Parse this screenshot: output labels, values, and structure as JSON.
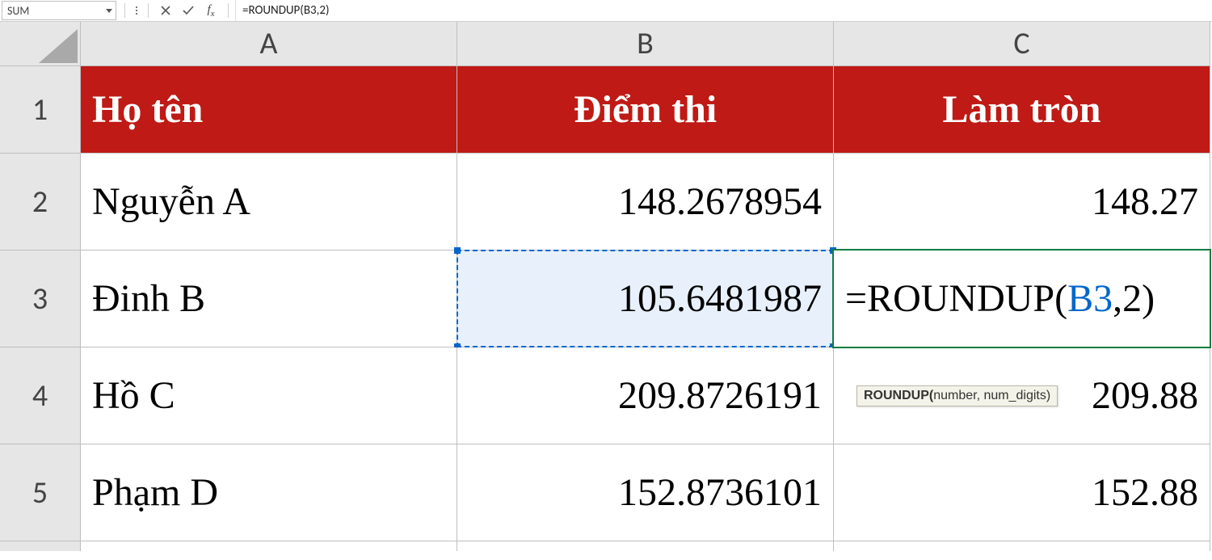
{
  "formula_bar": {
    "name_box": "SUM",
    "formula": "=ROUNDUP(B3,2)"
  },
  "columns": [
    "A",
    "B",
    "C"
  ],
  "row_numbers": [
    "1",
    "2",
    "3",
    "4",
    "5"
  ],
  "table": {
    "header": {
      "A": "Họ tên",
      "B": "Điểm thi",
      "C": "Làm tròn"
    },
    "rows": [
      {
        "A": "Nguyễn A",
        "B": "148.2678954",
        "C": "148.27"
      },
      {
        "A": "Đinh B",
        "B": "105.6481987",
        "C_formula": {
          "pre": "=ROUNDUP(",
          "ref": "B3",
          "post": ",2)"
        }
      },
      {
        "A": "Hồ C",
        "B": "209.8726191",
        "C": "209.88"
      },
      {
        "A": "Phạm D",
        "B": "152.8736101",
        "C": "152.88"
      }
    ]
  },
  "tooltip": {
    "fn": "ROUNDUP(",
    "args": "number, num_digits)"
  },
  "chart_data": {
    "type": "table",
    "columns": [
      "Họ tên",
      "Điểm thi",
      "Làm tròn"
    ],
    "rows": [
      [
        "Nguyễn A",
        148.2678954,
        148.27
      ],
      [
        "Đinh B",
        105.6481987,
        null
      ],
      [
        "Hồ C",
        209.8726191,
        209.88
      ],
      [
        "Phạm D",
        152.8736101,
        152.88
      ]
    ],
    "editing_cell": {
      "address": "C3",
      "formula": "=ROUNDUP(B3,2)"
    },
    "referenced_cell": "B3"
  }
}
